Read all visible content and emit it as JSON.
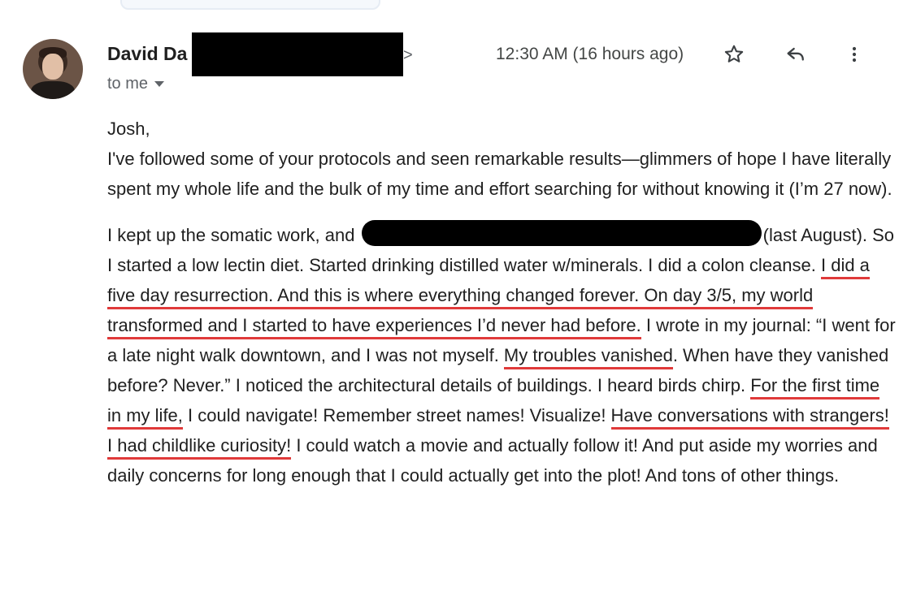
{
  "header": {
    "sender_name": "David Da",
    "sender_email_suffix": ">",
    "recipient": "to me",
    "timestamp": "12:30 AM (16 hours ago)",
    "icons": {
      "star": "star-icon",
      "reply": "reply-icon",
      "more": "more-vert-icon"
    }
  },
  "body": {
    "greeting": "Josh,",
    "p1": "I've followed some of your protocols and seen remarkable results—glimmers of hope I have literally spent my whole life and the bulk of my time and effort searching for without knowing it (I’m 27 now).",
    "p2_before_redaction": "I kept up the somatic work, and",
    "p2_after_redaction": "(last August). So I started a low lectin diet. Started drinking distilled water w/minerals. I did a colon cleanse. ",
    "u1": "I did a five day resurrection. And this is where everything changed forever. On day 3/5, my world transformed and I started to have experiences I’d never had before.",
    "t1": " I wrote in my journal: “I went for a late night walk downtown, and I was not myself. ",
    "u2": "My troubles vanished",
    "t2": ". When have they vanished before? Never.” I noticed the architectural details of buildings. I heard birds chirp. ",
    "u3": "For the first time in my life,",
    "t3": " I could navigate! Remember street names! Visualize! ",
    "u4": "Have conversations with strangers! I had childlike curiosity!",
    "t4": " I could watch a movie and actually follow it! And put aside my worries and daily concerns for long enough that I could actually get into the plot! And tons of other things."
  },
  "colors": {
    "underline": "#e03a3a",
    "redaction": "#000000",
    "meta_text": "#5f6368"
  }
}
